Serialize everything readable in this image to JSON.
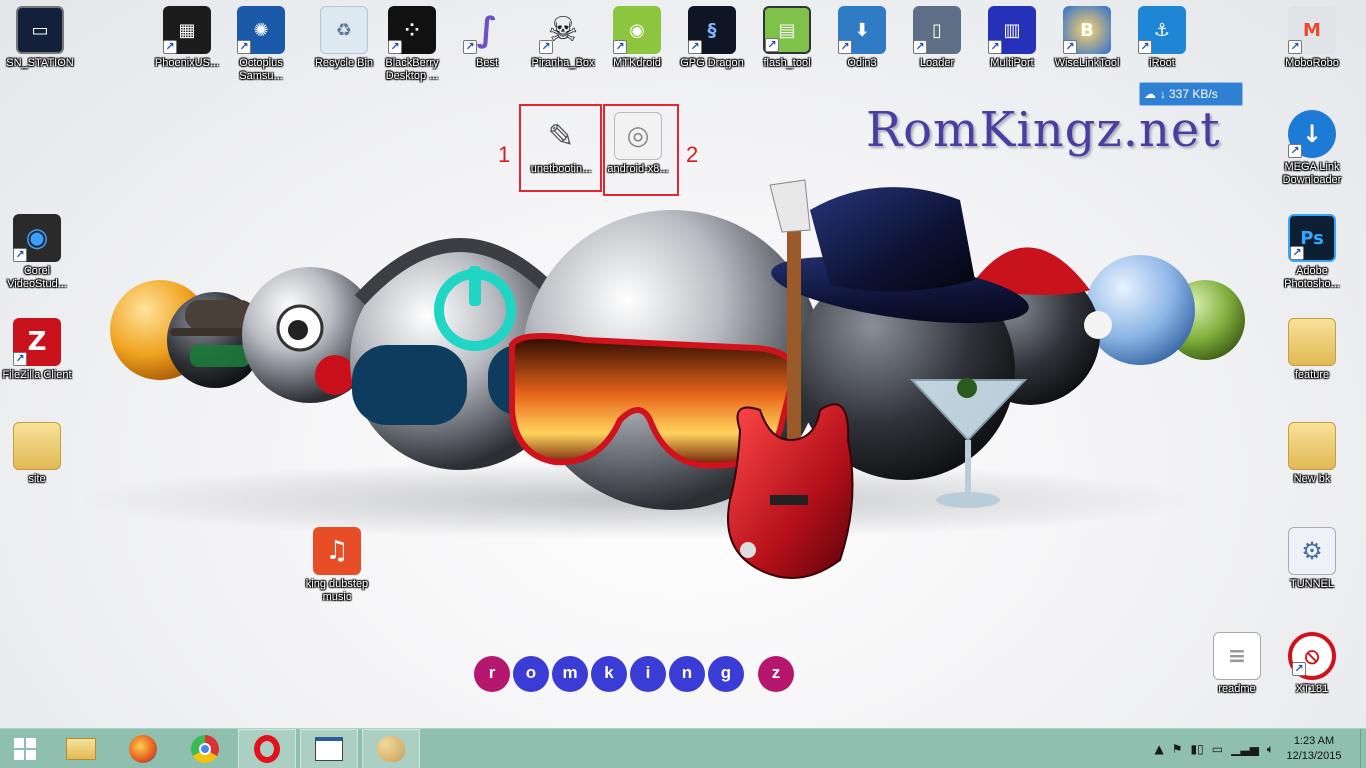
{
  "desktop": {
    "icons_top": [
      {
        "label": "SN_STATION",
        "shortcut": false
      },
      {
        "label": "PhoenixUS...",
        "shortcut": true
      },
      {
        "label": "Octoplus Samsu...",
        "shortcut": true
      },
      {
        "label": "Recycle Bin",
        "shortcut": false
      },
      {
        "label": "BlackBerry Desktop ...",
        "shortcut": true
      },
      {
        "label": "Best",
        "shortcut": true
      },
      {
        "label": "Piranha_Box",
        "shortcut": true
      },
      {
        "label": "MTKdroid",
        "shortcut": true
      },
      {
        "label": "GPG Dragon",
        "shortcut": true
      },
      {
        "label": "flash_tool",
        "shortcut": true
      },
      {
        "label": "Odin3",
        "shortcut": true
      },
      {
        "label": "Loader",
        "shortcut": true
      },
      {
        "label": "MultiPort",
        "shortcut": true
      },
      {
        "label": "WiseLinkTool",
        "shortcut": true
      },
      {
        "label": "iRoot",
        "shortcut": true
      },
      {
        "label": "MoboRobo",
        "shortcut": true
      }
    ],
    "icons_left": [
      {
        "label": "Corel VideoStud...",
        "shortcut": true
      },
      {
        "label": "FileZilla Client",
        "shortcut": true
      },
      {
        "label": "site",
        "shortcut": false
      }
    ],
    "icons_right": [
      {
        "label": "MEGA Link Downloader",
        "shortcut": true
      },
      {
        "label": "Adobe Photosho...",
        "shortcut": true
      },
      {
        "label": "feature",
        "shortcut": false
      },
      {
        "label": "New bk",
        "shortcut": false
      },
      {
        "label": "TUNNEL",
        "shortcut": false
      },
      {
        "label": "readme",
        "shortcut": false
      },
      {
        "label": "XT181",
        "shortcut": true
      }
    ],
    "highlighted": [
      {
        "label": "unetbootin...",
        "number": "1"
      },
      {
        "label": "android-x8...",
        "number": "2"
      }
    ],
    "music_icon": {
      "label": "king dubstep music"
    },
    "brand_text": "RomKingz.net",
    "speed_widget": "337 KB/s",
    "letter_dots": [
      "r",
      "o",
      "m",
      "k",
      "i",
      "n",
      "g",
      "z"
    ]
  },
  "taskbar": {
    "pinned": [
      "start-button",
      "file-explorer",
      "firefox",
      "chrome",
      "opera",
      "notepad-window",
      "paint"
    ],
    "clock_time": "1:23 AM",
    "clock_date": "12/13/2015"
  },
  "colors": {
    "taskbar": "#8fbfae",
    "highlight": "#e32636",
    "dot_magenta": "#b5176f",
    "dot_blue": "#3b3bd6"
  }
}
